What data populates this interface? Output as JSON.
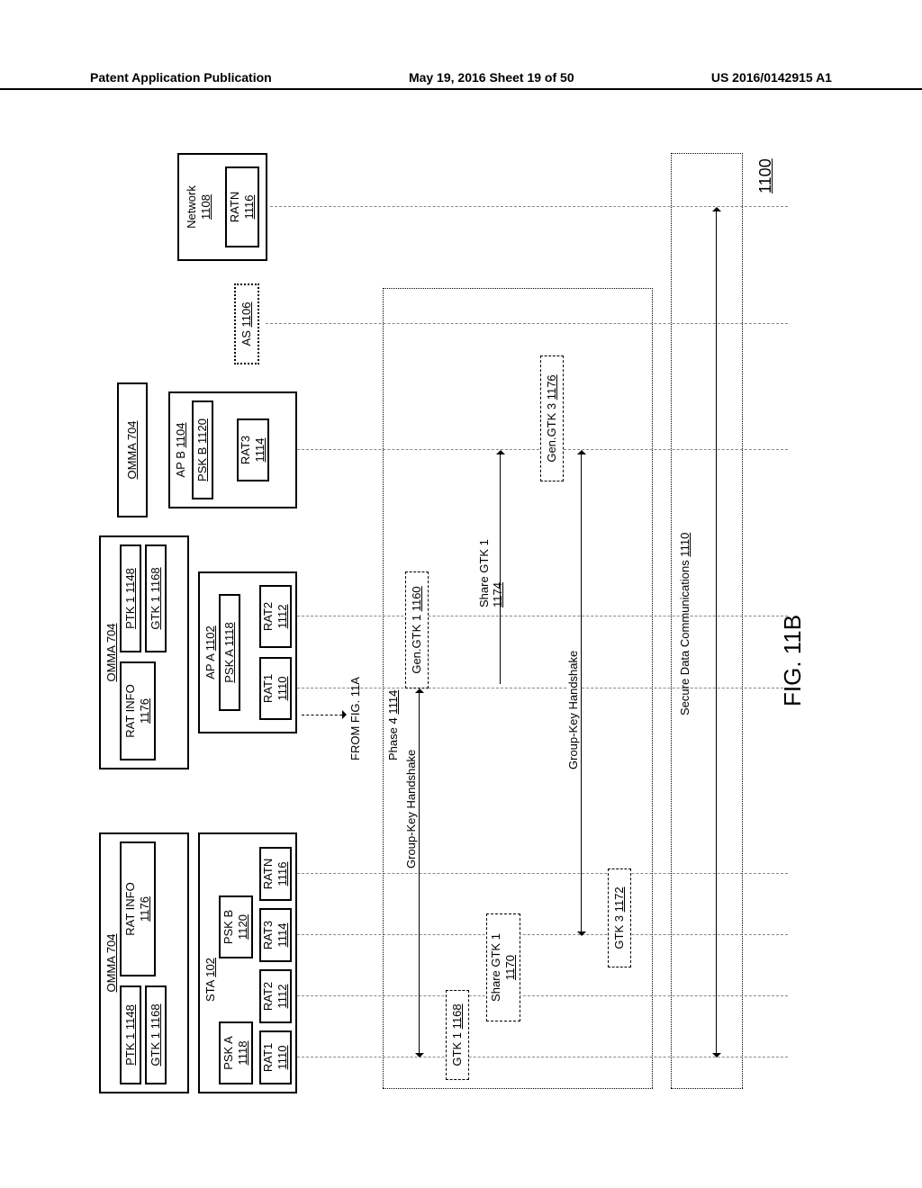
{
  "header": {
    "left": "Patent Application Publication",
    "center": "May 19, 2016  Sheet 19 of 50",
    "right": "US 2016/0142915 A1"
  },
  "figure": {
    "caption": "FIG. 11B",
    "ref": "1100",
    "from": "FROM FIG. 11A"
  },
  "omma_sta": {
    "title": "OMMA 704",
    "ptk": "PTK 1 1148",
    "ratinfo": "RAT INFO 1176",
    "gtk": "GTK 1 1168"
  },
  "sta": {
    "title": "STA 102",
    "pska": "PSK A 1118",
    "pskb": "PSK B 1120",
    "rat1": "RAT1 1110",
    "rat2": "RAT2 1112",
    "rat3": "RAT3 1114",
    "ratn": "RATN 1116"
  },
  "omma_apa": {
    "title": "OMMA 704",
    "ratinfo": "RAT INFO 1176",
    "ptk": "PTK 1 1148",
    "gtk": "GTK 1 1168"
  },
  "apa": {
    "title": "AP A 1102",
    "psk": "PSK A 1118",
    "rat1": "RAT1 1110",
    "rat2": "RAT2 1112"
  },
  "omma_apb": {
    "title": "OMMA 704"
  },
  "apb": {
    "title": "AP B 1104",
    "psk": "PSK B 1120",
    "rat3": "RAT3 1114"
  },
  "as": {
    "title": "AS 1106"
  },
  "network": {
    "title": "Network 1108",
    "ratn": "RATN 1116"
  },
  "phase4": {
    "label": "Phase 4 1114",
    "group_key_hs": "Group-Key Handshake",
    "gen_gtk1": "Gen.GTK 1 1160",
    "gtk1": "GTK 1 1168",
    "share_gtk1_left": "Share GTK 1 1170",
    "share_gtk1_right": "Share GTK 1 1174",
    "gen_gtk3": "Gen.GTK 3 1176",
    "gtk3": "GTK 3 1172"
  },
  "secure": "Secure Data Communications 1110"
}
